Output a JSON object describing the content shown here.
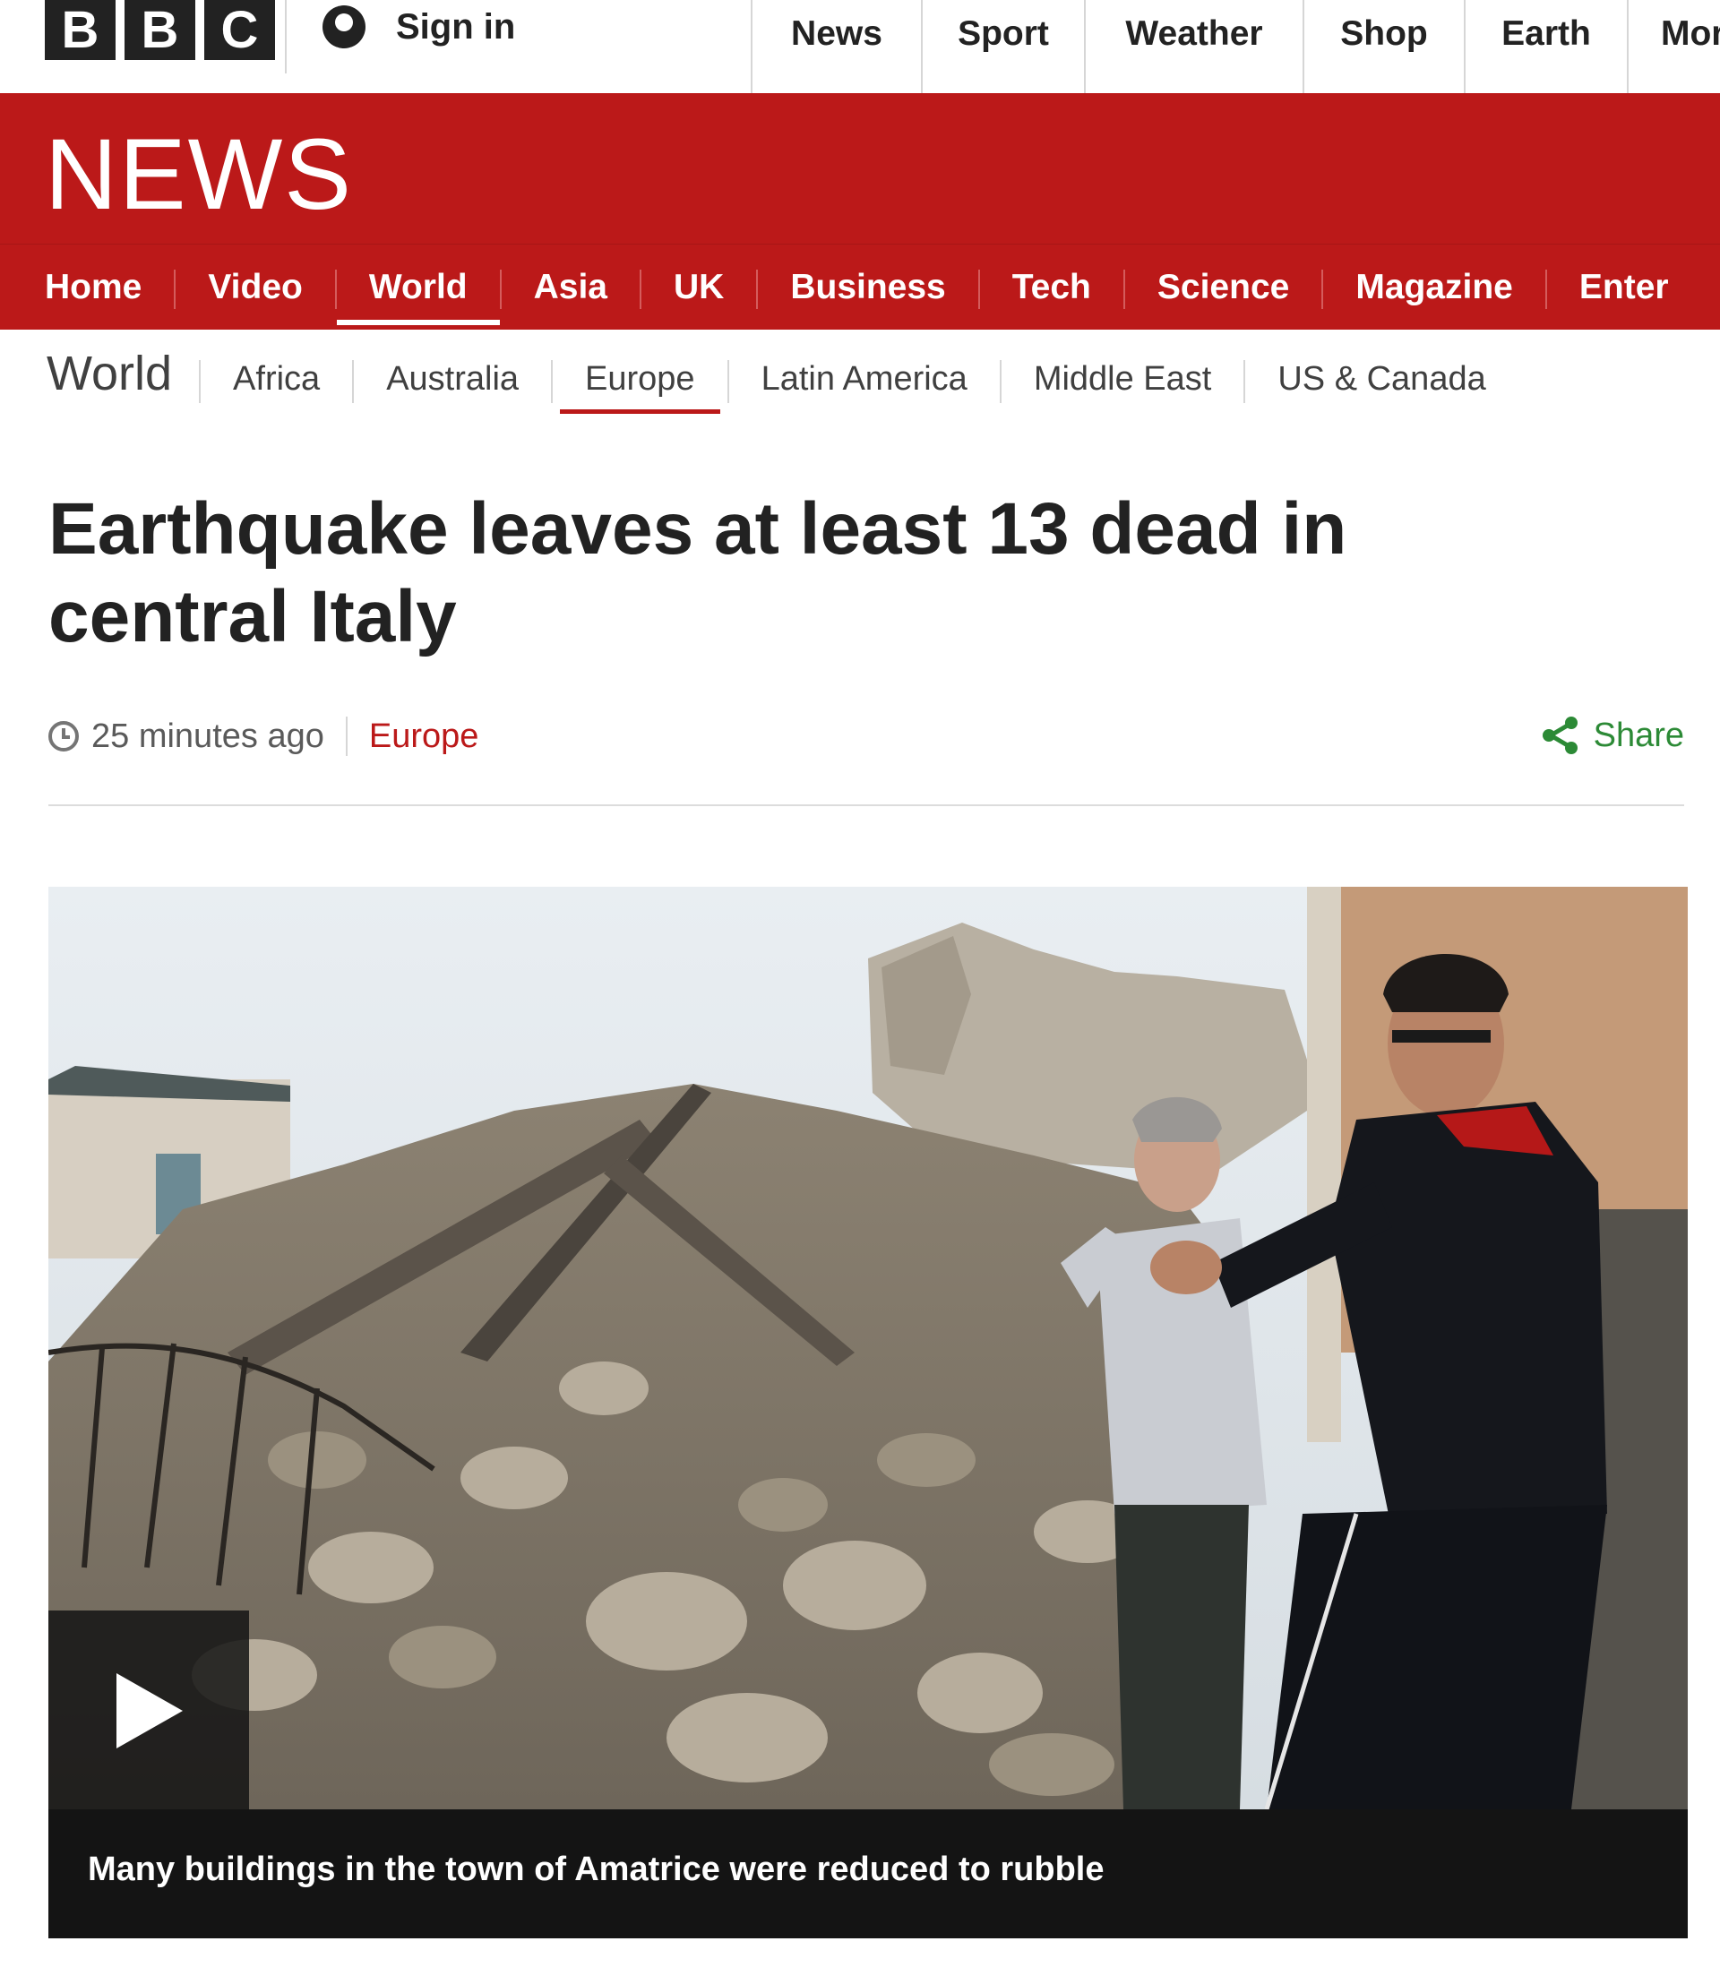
{
  "brand": {
    "logo_letters": [
      "B",
      "B",
      "C"
    ]
  },
  "topbar": {
    "signin_label": "Sign in",
    "nav": [
      "News",
      "Sport",
      "Weather",
      "Shop",
      "Earth",
      "Mor"
    ]
  },
  "news_band": {
    "title": "NEWS"
  },
  "main_nav": {
    "items": [
      "Home",
      "Video",
      "World",
      "Asia",
      "UK",
      "Business",
      "Tech",
      "Science",
      "Magazine",
      "Enter"
    ],
    "active": "World"
  },
  "sub_nav": {
    "section": "World",
    "items": [
      "Africa",
      "Australia",
      "Europe",
      "Latin America",
      "Middle East",
      "US & Canada"
    ],
    "active": "Europe"
  },
  "article": {
    "headline": "Earthquake leaves at least 13 dead in central Italy",
    "timestamp": "25 minutes ago",
    "section": "Europe",
    "share_label": "Share"
  },
  "media": {
    "caption": "Many buildings in the town of Amatrice were reduced to rubble"
  },
  "colors": {
    "brand_red": "#bb1919",
    "share_green": "#2c8a36",
    "logo_black": "#222222"
  },
  "icons": {
    "signin": "user-icon",
    "timestamp": "clock-icon",
    "share": "share-icon",
    "media": "play-icon"
  }
}
